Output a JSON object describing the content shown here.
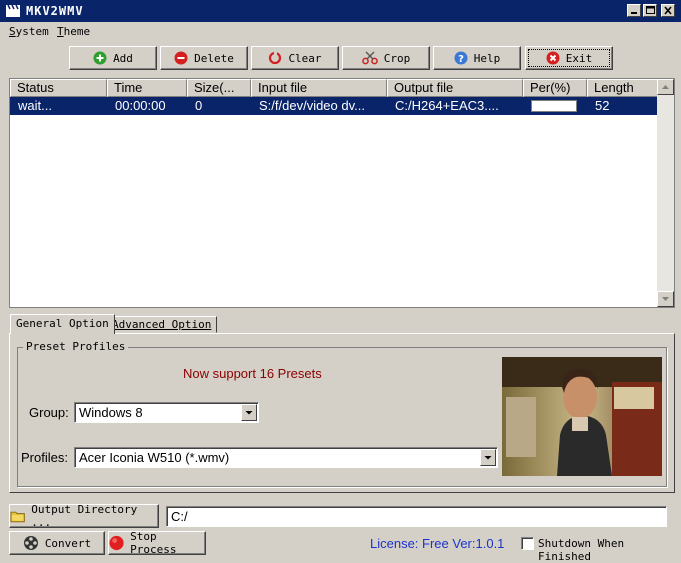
{
  "window": {
    "title": "MKV2WMV"
  },
  "menu": [
    {
      "label": "System",
      "accel": "S",
      "rest": "ystem"
    },
    {
      "label": "Theme",
      "accel": "T",
      "rest": "heme"
    }
  ],
  "toolbar": {
    "add": "Add",
    "delete": "Delete",
    "clear": "Clear",
    "crop": "Crop",
    "help": "Help",
    "exit": "Exit"
  },
  "table": {
    "columns": [
      "Status",
      "Time",
      "Size(...",
      "Input file",
      "Output file",
      "Per(%)",
      "Length"
    ],
    "rows": [
      {
        "status": "wait...",
        "time": "00:00:00",
        "size": "0",
        "input": "S:/f/dev/video dv...",
        "output": "C:/H264+EAC3....",
        "per": 0,
        "length": "52"
      }
    ]
  },
  "tabs": {
    "general": "General Option",
    "advanced": "Advanced Option"
  },
  "presets": {
    "group_title": "Preset Profiles",
    "support_text": "Now support 16 Presets",
    "group_label": "Group:",
    "group_value": "Windows 8",
    "profiles_label": "Profiles:",
    "profiles_value": "Acer Iconia W510 (*.wmv)"
  },
  "output": {
    "dir_button": "Output Directory ...",
    "dir_value": "C:/"
  },
  "bottom": {
    "convert": "Convert",
    "stop": "Stop Process",
    "license": "License: Free Ver:1.0.1",
    "shutdown": "Shutdown When Finished"
  },
  "colors": {
    "titlebar": "#0a246a",
    "selection": "#0a246a",
    "support_text": "#8b0000",
    "license": "#1a33cc"
  }
}
